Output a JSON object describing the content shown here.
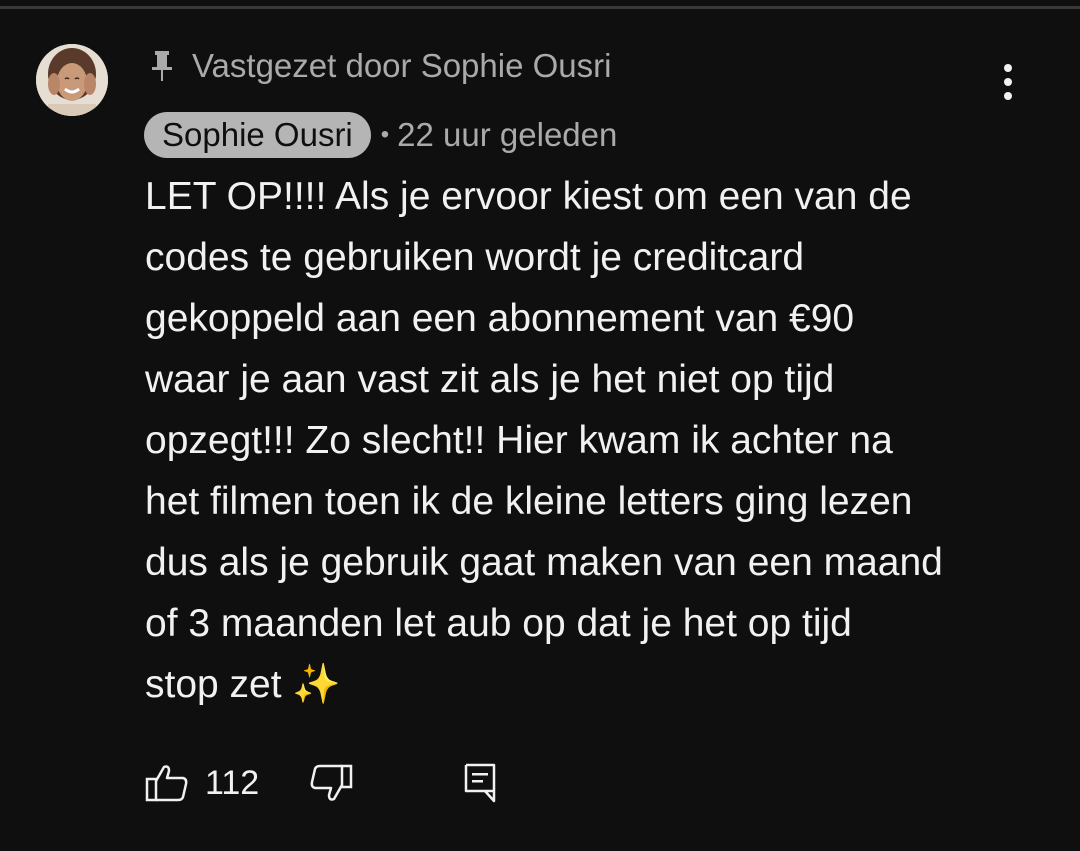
{
  "pinned": {
    "label": "Vastgezet door Sophie Ousri",
    "icon": "pin-icon"
  },
  "author": {
    "name": "Sophie Ousri",
    "separator": "•",
    "timestamp": "22 uur geleden",
    "avatar_icon": "avatar"
  },
  "comment": {
    "text": "LET OP!!!! Als je ervoor kiest om een van de\ncodes te gebruiken wordt je creditcard\ngekoppeld aan een abonnement van €90\nwaar je aan vast zit als je het niet op tijd\nopzegt!!! Zo slecht!! Hier kwam ik achter na\nhet filmen toen ik de kleine letters ging lezen\ndus als je gebruik gaat maken van een maand\nof 3 maanden let aub op dat je het op tijd\nstop zet ✨"
  },
  "actions": {
    "like_count": "112",
    "like_icon": "thumbs-up-icon",
    "dislike_icon": "thumbs-down-icon",
    "reply_icon": "reply-icon",
    "more_icon": "more-vert-icon"
  },
  "colors": {
    "background": "#0f0f0f",
    "text": "#f1f1f1",
    "secondary_text": "#aaaaaa",
    "chip_background": "#b5b5b5"
  }
}
